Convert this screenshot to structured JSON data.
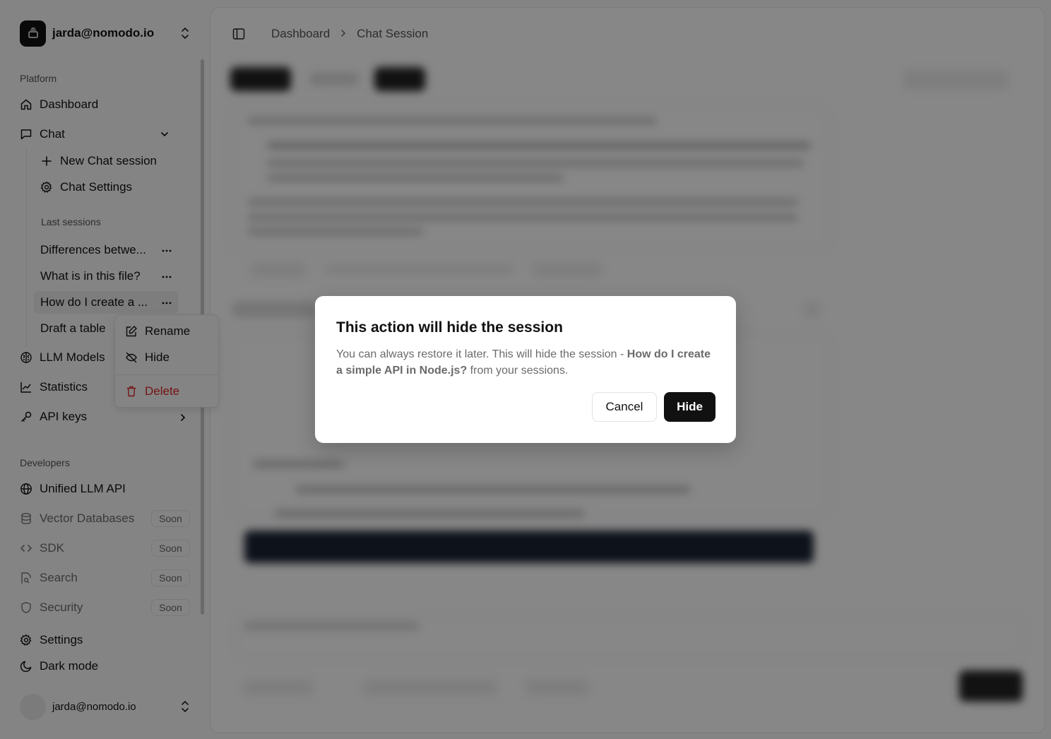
{
  "workspace": {
    "name": "jarda@nomodo.io"
  },
  "breadcrumb": {
    "items": [
      "Dashboard",
      "Chat Session"
    ]
  },
  "sidebar": {
    "platform_label": "Platform",
    "dashboard": "Dashboard",
    "chat": "Chat",
    "new_chat": "New Chat session",
    "chat_settings": "Chat Settings",
    "last_sessions_label": "Last sessions",
    "sessions": [
      "Differences betwe...",
      "What is in this file?",
      "How do I create a ...",
      "Draft a table"
    ],
    "llm_models": "LLM Models",
    "statistics": "Statistics",
    "api_keys": "API keys",
    "developers_label": "Developers",
    "unified_llm_api": "Unified LLM API",
    "vector_databases": "Vector Databases",
    "sdk": "SDK",
    "search": "Search",
    "security": "Security",
    "soon_badge": "Soon",
    "settings": "Settings",
    "dark_mode": "Dark mode"
  },
  "user": {
    "email": "jarda@nomodo.io"
  },
  "context_menu": {
    "rename": "Rename",
    "hide": "Hide",
    "delete": "Delete"
  },
  "dialog": {
    "title": "This action will hide the session",
    "desc_prefix": "You can always restore it later. This will hide the session - ",
    "session_name": "How do I create a simple API in Node.js?",
    "desc_suffix": " from your sessions.",
    "cancel_label": "Cancel",
    "confirm_label": "Hide"
  },
  "colors": {
    "primary": "#111111",
    "danger": "#dc2626",
    "muted_text": "#6b6b6b",
    "overlay": "rgba(0,0,0,0.47)"
  }
}
